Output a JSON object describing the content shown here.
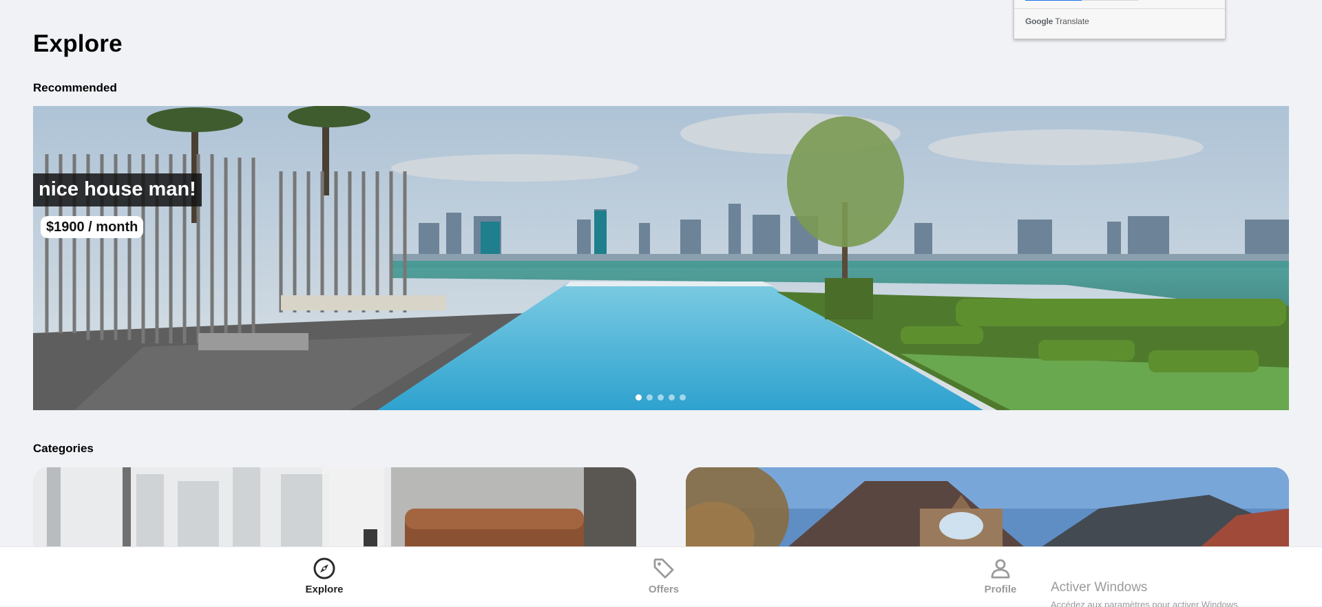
{
  "page": {
    "title": "Explore",
    "recommended_label": "Recommended",
    "categories_label": "Categories"
  },
  "hero": {
    "title": "nice house man!",
    "price": "$1900 / month",
    "slide_count": 5,
    "active_slide": 1
  },
  "nav": {
    "items": [
      {
        "label": "Explore",
        "icon": "compass-icon",
        "active": true
      },
      {
        "label": "Offers",
        "icon": "tag-icon",
        "active": false
      },
      {
        "label": "Profile",
        "icon": "person-icon",
        "active": false
      }
    ]
  },
  "translate_popup": {
    "brand_google": "Google",
    "brand_translate": "Translate"
  },
  "watermark": {
    "title": "Activer Windows",
    "subtitle": "Accédez aux paramètres pour activer Windows."
  },
  "colors": {
    "background": "#f1f2f6",
    "nav_active": "#222222",
    "nav_inactive": "#9a9a9a",
    "pool": "#4fb4d8"
  }
}
